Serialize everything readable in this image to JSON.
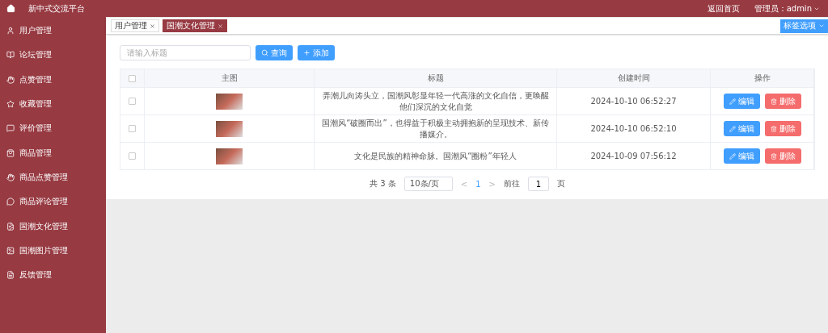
{
  "header": {
    "title": "新中式交流平台",
    "home_link": "返回首页",
    "user_menu": "管理员：admin"
  },
  "sidebar": {
    "items": [
      {
        "label": "用户管理",
        "selected": false
      },
      {
        "label": "论坛管理",
        "selected": false
      },
      {
        "label": "点赞管理",
        "selected": false
      },
      {
        "label": "收藏管理",
        "selected": false
      },
      {
        "label": "评价管理",
        "selected": false
      },
      {
        "label": "商品管理",
        "selected": false
      },
      {
        "label": "商品点赞管理",
        "selected": false
      },
      {
        "label": "商品评论管理",
        "selected": false
      },
      {
        "label": "国潮文化管理",
        "selected": false
      },
      {
        "label": "国潮图片管理",
        "selected": false
      },
      {
        "label": "反馈管理",
        "selected": false
      }
    ]
  },
  "tabs": [
    {
      "label": "用户管理",
      "selected": false
    },
    {
      "label": "国潮文化管理",
      "selected": true
    }
  ],
  "tab_options": "标签选项",
  "search": {
    "placeholder": "请输入标题",
    "query_button": "查询",
    "add_button": "添加"
  },
  "table": {
    "all_checked": false,
    "columns": [
      "主图",
      "标题",
      "创建时间",
      "操作"
    ],
    "rows": [
      {
        "checked": false,
        "title": "弄潮儿向涛头立，国潮风彰显年轻一代高涨的文化自信，更唤醒他们深沉的文化自觉",
        "created": "2024-10-10 06:52:27",
        "edit": "编辑",
        "delete": "删除"
      },
      {
        "checked": false,
        "title": "国潮风“破圈而出”，也得益于积极主动拥抱新的呈现技术、新传播媒介。",
        "created": "2024-10-10 06:52:10",
        "edit": "编辑",
        "delete": "删除"
      },
      {
        "checked": false,
        "title": "文化是民族的精神命脉。国潮风“圈粉”年轻人",
        "created": "2024-10-09 07:56:12",
        "edit": "编辑",
        "delete": "删除"
      }
    ]
  },
  "pagination": {
    "total": "共 3 条",
    "page_size": "10条/页",
    "prev": "<",
    "pages": [
      {
        "label": "1",
        "selected": true
      }
    ],
    "next": ">",
    "goto_label": "前往",
    "goto_value": "1",
    "page_suffix": "页"
  }
}
